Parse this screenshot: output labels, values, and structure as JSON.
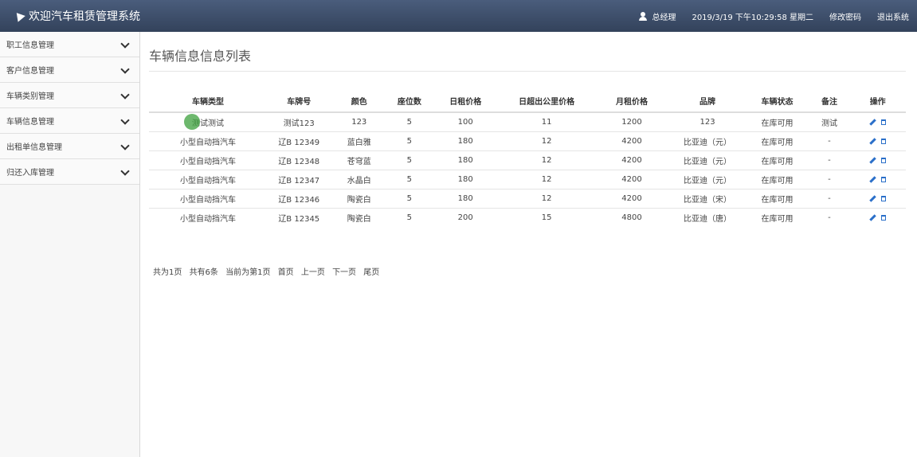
{
  "header": {
    "title": "欢迎汽车租赁管理系统",
    "user": "总经理",
    "datetime": "2019/3/19 下午10:29:58 星期二",
    "change_password": "修改密码",
    "logout": "退出系统",
    "icons": {
      "logo": "paper-plane-icon",
      "user": "user-icon"
    }
  },
  "sidebar": {
    "items": [
      {
        "label": "职工信息管理"
      },
      {
        "label": "客户信息管理"
      },
      {
        "label": "车辆类别管理"
      },
      {
        "label": "车辆信息管理"
      },
      {
        "label": "出租单信息管理"
      },
      {
        "label": "归还入库管理"
      }
    ]
  },
  "main": {
    "title": "车辆信息信息列表",
    "columns": [
      "车辆类型",
      "车牌号",
      "颜色",
      "座位数",
      "日租价格",
      "日超出公里价格",
      "月租价格",
      "品牌",
      "车辆状态",
      "备注",
      "操作"
    ],
    "rows": [
      [
        "测试测试",
        "测试123",
        "123",
        "5",
        "100",
        "11",
        "1200",
        "123",
        "在库可用",
        "测试"
      ],
      [
        "小型自动挡汽车",
        "辽B 12349",
        "蓝白雅",
        "5",
        "180",
        "12",
        "4200",
        "比亚迪（元）",
        "在库可用",
        "-"
      ],
      [
        "小型自动挡汽车",
        "辽B 12348",
        "苍穹蓝",
        "5",
        "180",
        "12",
        "4200",
        "比亚迪（元）",
        "在库可用",
        "-"
      ],
      [
        "小型自动挡汽车",
        "辽B 12347",
        "水晶白",
        "5",
        "180",
        "12",
        "4200",
        "比亚迪（元）",
        "在库可用",
        "-"
      ],
      [
        "小型自动挡汽车",
        "辽B 12346",
        "陶瓷白",
        "5",
        "180",
        "12",
        "4200",
        "比亚迪（宋）",
        "在库可用",
        "-"
      ],
      [
        "小型自动挡汽车",
        "辽B 12345",
        "陶瓷白",
        "5",
        "200",
        "15",
        "4800",
        "比亚迪（唐）",
        "在库可用",
        "-"
      ]
    ],
    "row_icons": {
      "edit": "pencil-icon",
      "delete": "trash-icon"
    }
  },
  "pager": {
    "total_pages": "共为1页",
    "total_records": "共有6条",
    "current": "当前为第1页",
    "first": "首页",
    "prev": "上一页",
    "next": "下一页",
    "last": "尾页"
  },
  "colors": {
    "header_bg": "#3b4a63",
    "icon_blue": "#2a6fc9"
  }
}
